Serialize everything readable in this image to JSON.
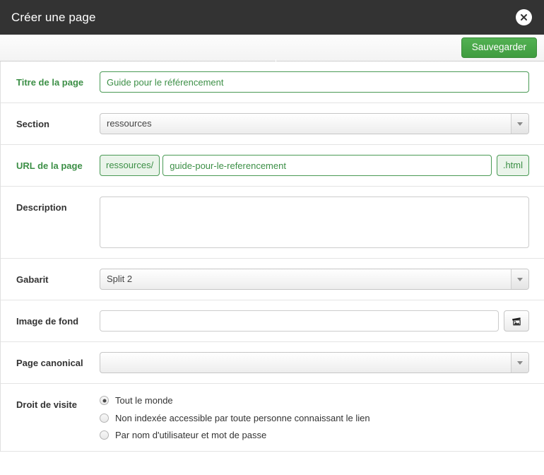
{
  "header": {
    "title": "Créer une page",
    "close_icon": "close-icon"
  },
  "toolbar": {
    "save_label": "Sauvegarder",
    "save_color": "#46a546"
  },
  "colors": {
    "header_bg": "#333333",
    "accent_green": "#3c8f46",
    "border": "#e4e4e4"
  },
  "form": {
    "rows": [
      {
        "label": "Titre de la page",
        "label_state": "valid",
        "type": "text",
        "value": "Guide pour le référencement",
        "placeholder": ""
      },
      {
        "label": "Section",
        "label_state": "normal",
        "type": "select",
        "value": "ressources"
      },
      {
        "label": "URL de la page",
        "label_state": "valid",
        "type": "url-group",
        "prefix": "ressources/",
        "value": "guide-pour-le-referencement",
        "suffix": ".html"
      },
      {
        "label": "Description",
        "label_state": "normal",
        "type": "textarea",
        "value": "",
        "placeholder": ""
      },
      {
        "label": "Gabarit",
        "label_state": "normal",
        "type": "select",
        "value": "Split 2"
      },
      {
        "label": "Image de fond",
        "label_state": "normal",
        "type": "image",
        "value": "",
        "placeholder": "",
        "button_icon": "picture-icon"
      },
      {
        "label": "Page canonical",
        "label_state": "normal",
        "type": "select",
        "value": ""
      },
      {
        "label": "Droit de visite",
        "label_state": "normal",
        "type": "radios",
        "options": [
          {
            "label": "Tout le monde",
            "checked": true
          },
          {
            "label": "Non indexée accessible par toute personne connaissant le lien",
            "checked": false
          },
          {
            "label": "Par nom d'utilisateur et mot de passe",
            "checked": false
          }
        ]
      }
    ]
  }
}
